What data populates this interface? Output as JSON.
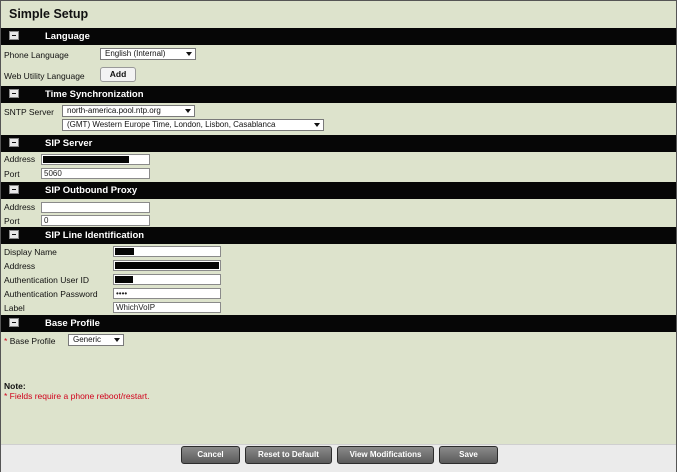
{
  "page": {
    "title": "Simple Setup"
  },
  "sections": {
    "language": "Language",
    "time": "Time Synchronization",
    "sip_server": "SIP Server",
    "outbound": "SIP Outbound Proxy",
    "line_id": "SIP Line Identification",
    "base_profile": "Base Profile"
  },
  "language": {
    "phone_language_label": "Phone Language",
    "phone_language_value": "English (Internal)",
    "web_language_label": "Web Utility Language",
    "add_button": "Add"
  },
  "time": {
    "sntp_label": "SNTP Server",
    "sntp_value": "north-america.pool.ntp.org",
    "timezone_value": "(GMT) Western Europe Time, London, Lisbon, Casablanca"
  },
  "sip_server": {
    "address_label": "Address",
    "address_value": "",
    "port_label": "Port",
    "port_value": "5060"
  },
  "outbound": {
    "address_label": "Address",
    "address_value": "",
    "port_label": "Port",
    "port_value": "0"
  },
  "line_id": {
    "display_name_label": "Display Name",
    "address_label": "Address",
    "auth_user_label": "Authentication User ID",
    "auth_password_label": "Authentication Password",
    "auth_password_value": "••••",
    "label_label": "Label",
    "label_value": "WhichVoIP"
  },
  "base_profile": {
    "required_marker": "*",
    "label": "Base Profile",
    "value": "Generic"
  },
  "note": {
    "title": "Note:",
    "text": "* Fields require a phone reboot/restart."
  },
  "buttons": {
    "cancel": "Cancel",
    "reset": "Reset to Default",
    "view": "View Modifications",
    "save": "Save"
  },
  "colors": {
    "background": "#dde3cc",
    "section_bar": "#060606",
    "required": "#d0021b"
  }
}
